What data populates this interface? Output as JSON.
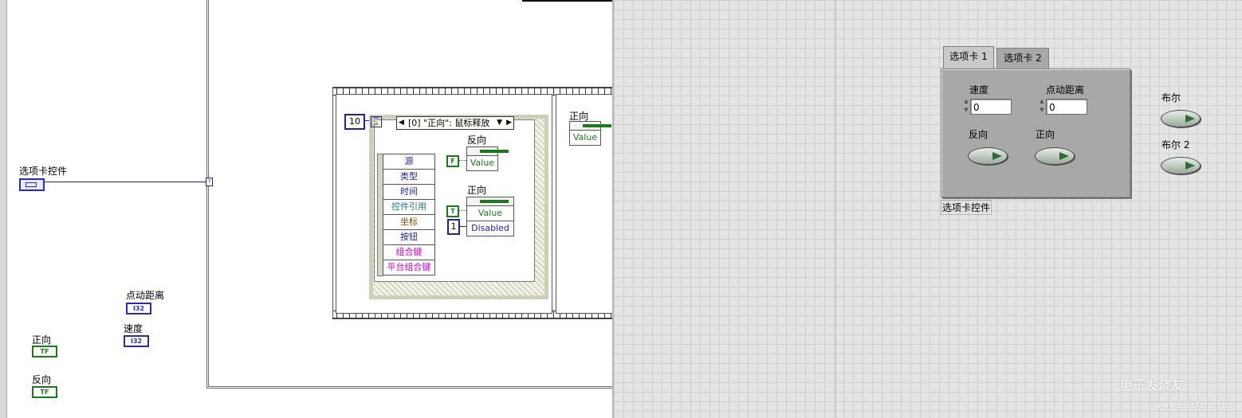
{
  "block_diagram": {
    "tab_control_label": "选项卡控件",
    "tunnel_glyph": "?",
    "jog_distance_label": "点动距离",
    "speed_label": "速度",
    "forward_label": "正向",
    "reverse_label": "反向",
    "i32_terminal": "I32",
    "tf_terminal": "TF",
    "timeout_constant": "10",
    "event_case_selector": "[0] \"正向\": 鼠标释放",
    "event_data_fields": [
      "源",
      "类型",
      "时间",
      "控件引用",
      "坐标",
      "按钮",
      "组合键",
      "平台组合键"
    ],
    "event_data_colors": [
      "#2020a0",
      "#2020a0",
      "#2020a0",
      "#1a7a7a",
      "#8a4a00",
      "#2020a0",
      "#cc00cc",
      "#cc00cc"
    ],
    "node_reverse": {
      "name": "反向",
      "row": "Value",
      "constant": "F"
    },
    "node_forward": {
      "name": "正向",
      "rows": [
        "Value",
        "Disabled"
      ],
      "constant_bool": "T",
      "constant_num": "1"
    },
    "frame2_node": {
      "name": "正向",
      "row": "Value"
    }
  },
  "front_panel": {
    "tabs": [
      {
        "label": "选项卡 1",
        "active": true
      },
      {
        "label": "选项卡 2",
        "active": false
      }
    ],
    "speed": {
      "label": "速度",
      "value": "0"
    },
    "jog_distance": {
      "label": "点动距离",
      "value": "0"
    },
    "reverse_button": {
      "label": "反向"
    },
    "forward_button": {
      "label": "正向"
    },
    "tab_control_label": "选项卡控件",
    "bool1_label": "布尔",
    "bool2_label": "布尔 2"
  },
  "watermark": {
    "text": "电子发烧友",
    "url": "www.elecfans.com"
  },
  "colors": {
    "blue_wire": "#2020a0",
    "green_bool": "#1a7a1a",
    "panel_gray": "#a8a8a8"
  }
}
